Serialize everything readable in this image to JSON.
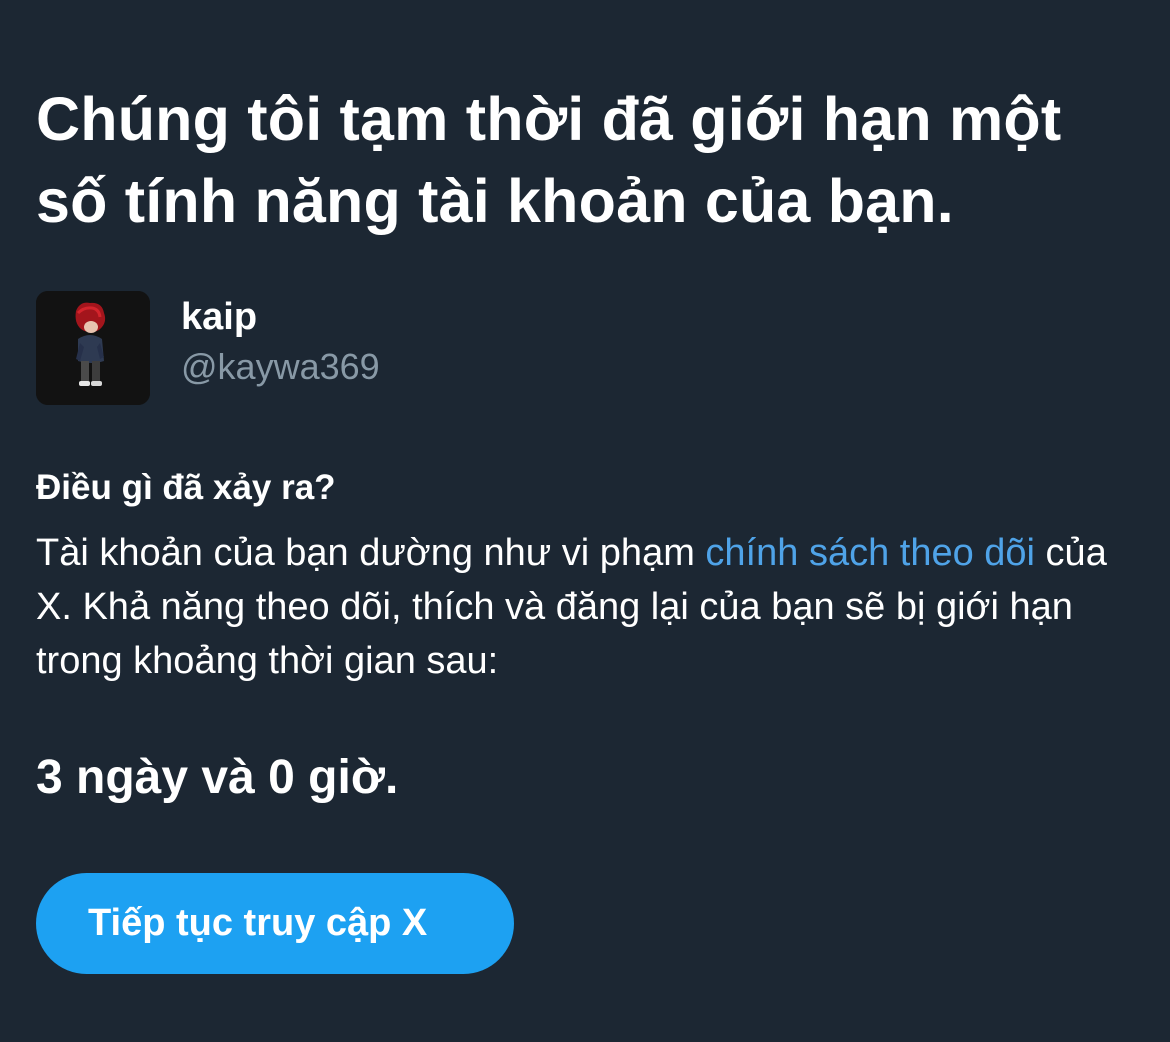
{
  "notice": {
    "title": "Chúng tôi tạm thời đã giới hạn một số tính năng tài khoản của bạn."
  },
  "account": {
    "display_name": "kaip",
    "handle": "@kaywa369"
  },
  "details": {
    "heading": "Điều gì đã xảy ra?",
    "body_before_link": "Tài khoản của bạn dường như vi phạm ",
    "link_text": "chính sách theo dõi",
    "body_after_link": " của X. Khả năng theo dõi, thích và đăng lại của bạn sẽ bị giới hạn trong khoảng thời gian sau:"
  },
  "duration": {
    "text": "3 ngày và 0 giờ."
  },
  "actions": {
    "continue_label": "Tiếp tục truy cập X"
  },
  "colors": {
    "background": "#1c2733",
    "link": "#4fa3e8",
    "button": "#1da1f2",
    "secondary_text": "#8899a6"
  }
}
